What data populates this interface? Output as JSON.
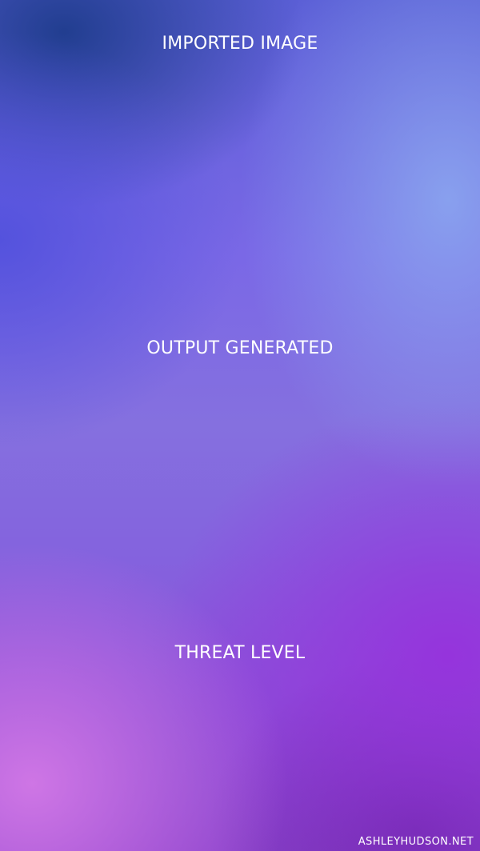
{
  "labels": {
    "imported": "IMPORTED IMAGE",
    "output": "OUTPUT GENERATED",
    "threat": "THREAT LEVEL"
  },
  "watermark": "ASHLEYHUDSON.NET"
}
